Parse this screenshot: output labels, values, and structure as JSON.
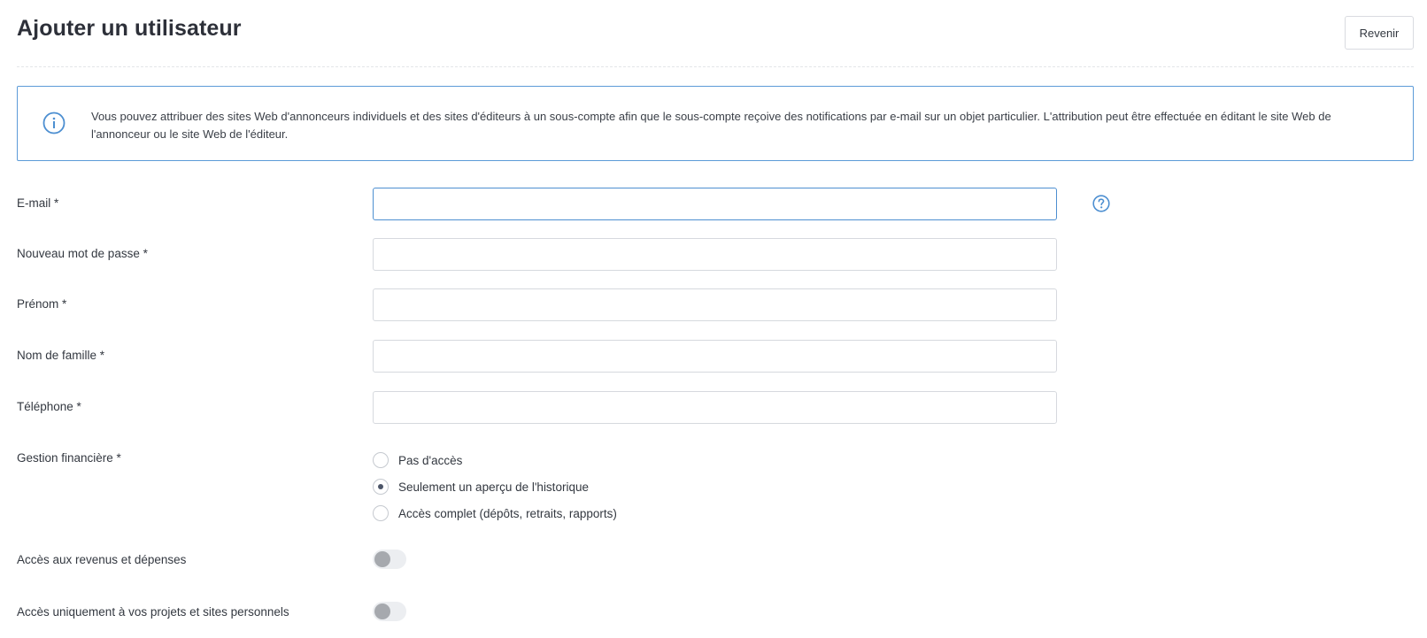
{
  "header": {
    "title": "Ajouter un utilisateur",
    "back_label": "Revenir"
  },
  "info": {
    "icon": "info-icon",
    "text": "Vous pouvez attribuer des sites Web d'annonceurs individuels et des sites d'éditeurs à un sous-compte afin que le sous-compte reçoive des notifications par e-mail sur un objet particulier. L'attribution peut être effectuée en éditant le site Web de l'annonceur ou le site Web de l'éditeur."
  },
  "form": {
    "email": {
      "label": "E-mail *",
      "value": "",
      "help_icon": "help-icon"
    },
    "password": {
      "label": "Nouveau mot de passe *",
      "value": ""
    },
    "first_name": {
      "label": "Prénom *",
      "value": ""
    },
    "last_name": {
      "label": "Nom de famille *",
      "value": ""
    },
    "phone": {
      "label": "Téléphone *",
      "value": ""
    },
    "financial": {
      "label": "Gestion financière *",
      "options": [
        {
          "label": "Pas d'accès",
          "selected": false
        },
        {
          "label": "Seulement un aperçu de l'historique",
          "selected": true
        },
        {
          "label": "Accès complet (dépôts, retraits, rapports)",
          "selected": false
        }
      ]
    },
    "revenue_access": {
      "label": "Accès aux revenus et dépenses",
      "enabled": false
    },
    "own_projects_access": {
      "label": "Accès uniquement à vos projets et sites personnels",
      "enabled": false
    }
  },
  "colors": {
    "accent": "#4d8fd1",
    "info_border": "#5c9bd8",
    "text": "#333840"
  }
}
